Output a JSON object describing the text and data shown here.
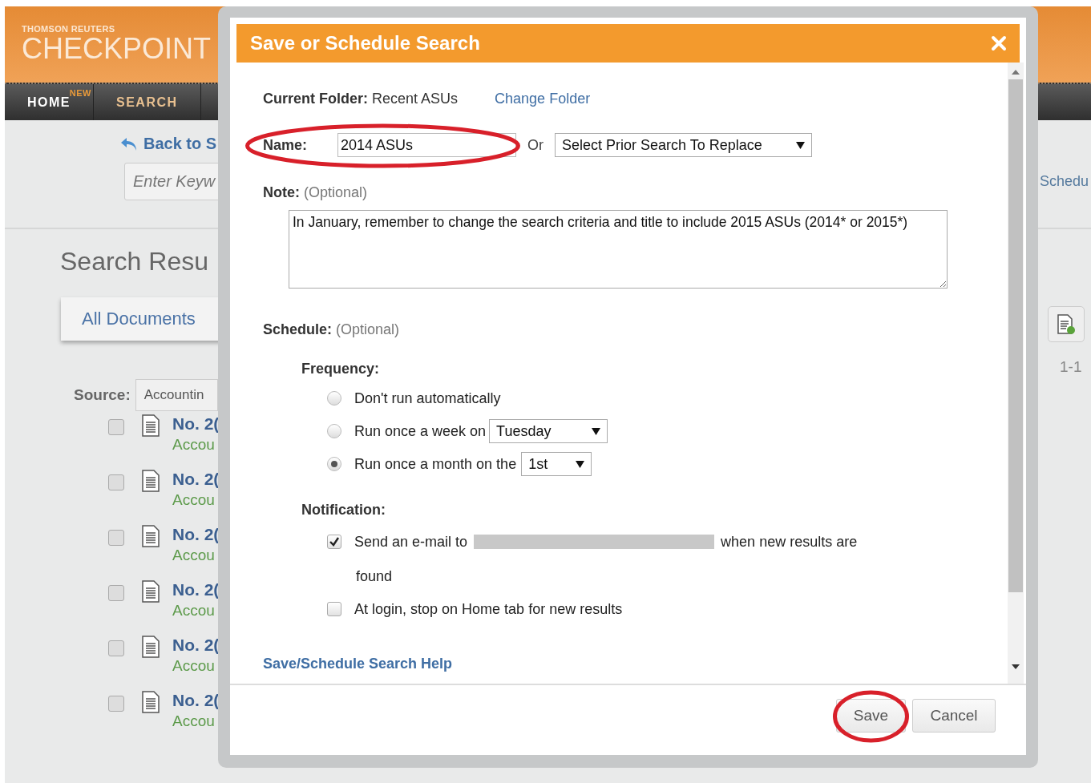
{
  "header": {
    "brand_top": "THOMSON REUTERS",
    "brand": "CHECKPOINT"
  },
  "nav": [
    {
      "label": "HOME",
      "badge": "NEW",
      "selected": false
    },
    {
      "label": "SEARCH",
      "selected": true
    }
  ],
  "back_link": "Back to S",
  "search_field": {
    "placeholder": "Enter Keyw"
  },
  "page_title": "Search Resu",
  "tab": "All Documents",
  "source": {
    "label": "Source:",
    "value": "Accountin"
  },
  "results": [
    {
      "title": "No. 2(",
      "source": "Accou",
      "checked": false
    },
    {
      "title": "No. 2(",
      "source": "Accou",
      "checked": false
    },
    {
      "title": "No. 2(",
      "source": "Accou",
      "checked": false
    },
    {
      "title": "No. 2(",
      "source": "Accou",
      "checked": false
    },
    {
      "title": "No. 2(",
      "source": "Accou",
      "checked": false
    },
    {
      "title": "No. 2(",
      "source": "Accou",
      "checked": false
    }
  ],
  "right_edge": {
    "link": "Schedu",
    "range": "1-1"
  },
  "dialog": {
    "title": "Save or Schedule Search",
    "current_folder": {
      "label": "Current Folder:",
      "value": "Recent ASUs"
    },
    "change_folder": "Change Folder",
    "name": {
      "label": "Name:",
      "value": "2014 ASUs",
      "highlighted": true
    },
    "or": "Or",
    "replace_select": "Select Prior Search To Replace",
    "note": {
      "label": "Note:",
      "hint": "(Optional)",
      "value": "In January, remember to change the search criteria and title to include 2015 ASUs (2014* or 2015*)"
    },
    "schedule": {
      "label": "Schedule:",
      "hint": "(Optional)"
    },
    "frequency": {
      "label": "Frequency:",
      "options": [
        {
          "label": "Don't run automatically",
          "selected": false
        },
        {
          "label": "Run once a week on",
          "selected": false,
          "select": "Tuesday"
        },
        {
          "label": "Run once a month on the",
          "selected": true,
          "select": "1st"
        }
      ]
    },
    "notification": {
      "label": "Notification:",
      "options": [
        {
          "label": "Send an e-mail to",
          "redacted": true,
          "after": "when new results are",
          "continuation": "found",
          "checked": true
        },
        {
          "label": "At login, stop on Home tab for new results",
          "checked": false
        }
      ]
    },
    "help_link": "Save/Schedule Search Help",
    "buttons": [
      {
        "label": "Save",
        "highlighted": true
      },
      {
        "label": "Cancel",
        "highlighted": false
      }
    ]
  }
}
